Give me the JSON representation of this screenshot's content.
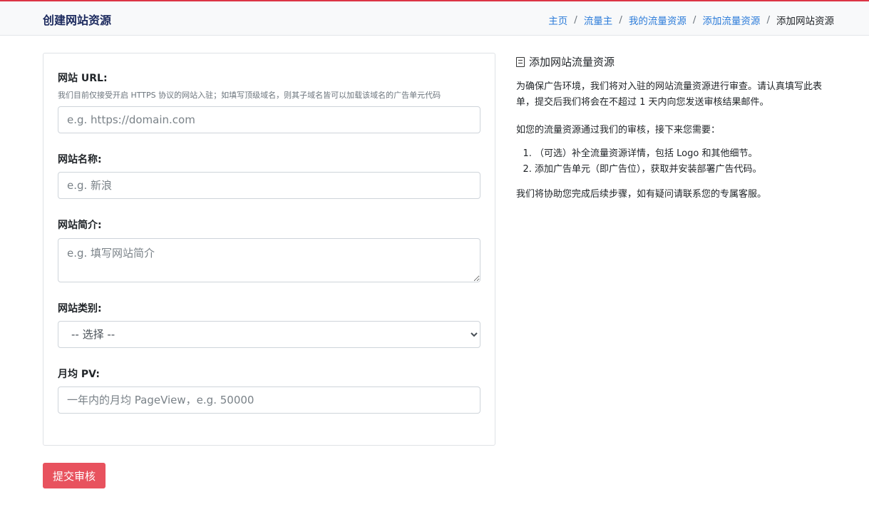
{
  "header": {
    "title": "创建网站资源",
    "breadcrumb": [
      {
        "label": "主页"
      },
      {
        "label": "流量主"
      },
      {
        "label": "我的流量资源"
      },
      {
        "label": "添加流量资源"
      },
      {
        "label": "添加网站资源"
      }
    ],
    "separator": "/"
  },
  "form": {
    "url": {
      "label": "网站 URL:",
      "hint": "我们目前仅接受开启 HTTPS 协议的网站入驻；如填写顶级域名，则其子域名皆可以加载该域名的广告单元代码",
      "placeholder": "e.g. https://domain.com",
      "value": ""
    },
    "name": {
      "label": "网站名称:",
      "placeholder": "e.g. 新浪",
      "value": ""
    },
    "intro": {
      "label": "网站简介:",
      "placeholder": "e.g. 填写网站简介",
      "value": ""
    },
    "category": {
      "label": "网站类别:",
      "selected": "-- 选择 --"
    },
    "pv": {
      "label": "月均 PV:",
      "placeholder": "一年内的月均 PageView，e.g. 50000",
      "value": ""
    },
    "submit_label": "提交审核"
  },
  "info": {
    "title": "添加网站流量资源",
    "intro": "为确保广告环境，我们将对入驻的网站流量资源进行审查。请认真填写此表单，提交后我们将会在不超过 1 天内向您发送审核结果邮件。",
    "next_steps_intro": "如您的流量资源通过我们的审核，接下来您需要：",
    "steps": [
      "（可选）补全流量资源详情，包括 Logo 和其他细节。",
      "添加广告单元（即广告位），获取并安装部署广告代码。"
    ],
    "closing": "我们将协助您完成后续步骤，如有疑问请联系您的专属客服。"
  },
  "colors": {
    "accent_red": "#e8525e",
    "link_blue": "#2b7bd9",
    "title_navy": "#1c2a5e"
  }
}
